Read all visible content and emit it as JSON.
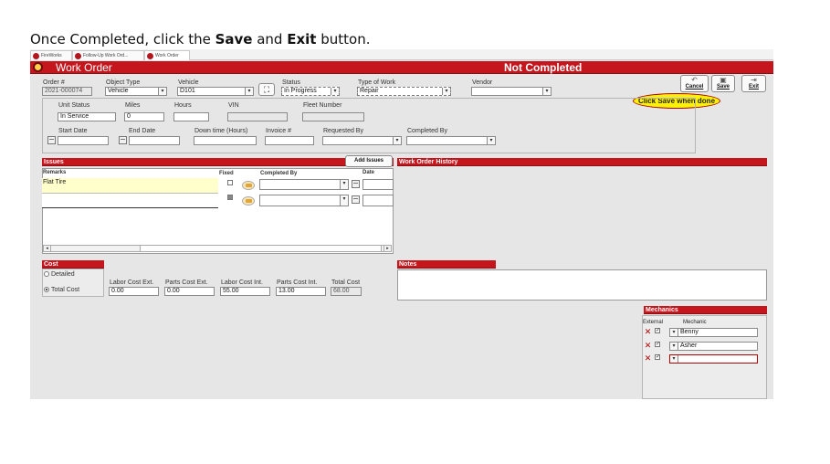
{
  "instruction": {
    "before": "Once Completed, click the ",
    "save_word": "Save",
    "middle": " and ",
    "exit_word": "Exit",
    "after": " button."
  },
  "tabs": [
    {
      "label": "FireWorks"
    },
    {
      "label": "Follow-Up Work Ord..."
    },
    {
      "label": "Work Order"
    }
  ],
  "header": {
    "title": "Work Order",
    "status": "Not Completed"
  },
  "row1": {
    "order_label": "Order #",
    "order_value": "2021-000074",
    "object_type_label": "Object Type",
    "object_type_value": "Vehicle",
    "vehicle_label": "Vehicle",
    "vehicle_value": "D101",
    "status_label": "Status",
    "status_value": "In Progress",
    "type_of_work_label": "Type of Work",
    "type_of_work_value": "Repair",
    "vendor_label": "Vendor",
    "vendor_value": ""
  },
  "buttons": {
    "cancel": "Cancel",
    "save": "Save",
    "exit": "Exit"
  },
  "callout": "Click Save when done",
  "row2": {
    "unit_status_label": "Unit Status",
    "unit_status_value": "In Service",
    "miles_label": "Miles",
    "miles_value": "0",
    "hours_label": "Hours",
    "hours_value": "",
    "vin_label": "VIN",
    "vin_value": "",
    "fleet_label": "Fleet Number",
    "fleet_value": ""
  },
  "row3": {
    "start_label": "Start Date",
    "end_label": "End Date",
    "downtime_label": "Down time (Hours)",
    "invoice_label": "Invoice #",
    "requested_label": "Requested By",
    "completed_label": "Completed By"
  },
  "issues": {
    "title": "Issues",
    "add_button": "Add Issues",
    "columns": {
      "remarks": "Remarks",
      "fixed": "Fixed",
      "completed_by": "Completed By",
      "date": "Date"
    },
    "rows": [
      {
        "remarks": "Flat Tire"
      },
      {
        "remarks": ""
      }
    ]
  },
  "history": {
    "title": "Work Order History"
  },
  "cost": {
    "title": "Cost",
    "opt_detailed": "Detailed",
    "opt_total": "Total Cost",
    "labor_ext_label": "Labor Cost Ext.",
    "labor_ext_value": "0.00",
    "parts_ext_label": "Parts Cost Ext.",
    "parts_ext_value": "0.00",
    "labor_int_label": "Labor Cost Int.",
    "labor_int_value": "55.00",
    "parts_int_label": "Parts Cost Int.",
    "parts_int_value": "13.00",
    "total_label": "Total Cost",
    "total_value": "68.00"
  },
  "notes": {
    "title": "Notes"
  },
  "mechanics": {
    "title": "Mechanics",
    "col_external": "External",
    "col_mechanic": "Mechanic",
    "rows": [
      {
        "name": "Benny"
      },
      {
        "name": "Asher"
      },
      {
        "name": ""
      }
    ]
  },
  "colors": {
    "brand_red": "#c4161c",
    "callout_yellow": "#fff200",
    "highlight_row": "#ffffcc"
  }
}
